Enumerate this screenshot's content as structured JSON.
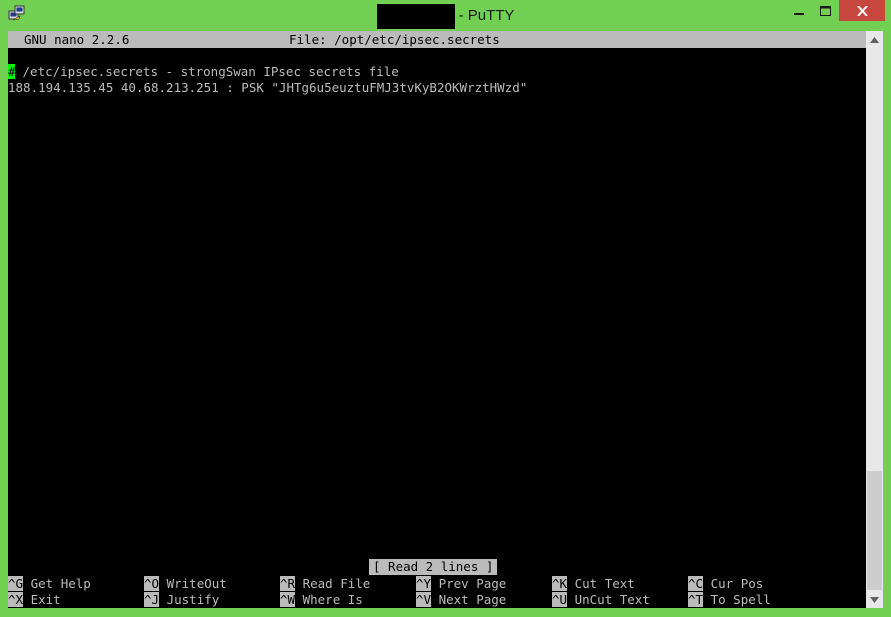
{
  "window": {
    "title_suffix": "- PuTTY",
    "accent": "#71d051",
    "close_color": "#c7463d"
  },
  "nano": {
    "version": "GNU nano 2.2.6",
    "file_label": "File: /opt/etc/ipsec.secrets",
    "lines": [
      {
        "first_char": "#",
        "rest": " /etc/ipsec.secrets - strongSwan IPsec secrets file"
      },
      {
        "text": "188.194.135.45 40.68.213.251 : PSK \"JHTg6u5euztuFMJ3tvKyB2OKWrztHWzd\""
      }
    ],
    "status": "[ Read 2 lines ]",
    "shortcuts_row1": [
      {
        "key": "^G",
        "label": "Get Help"
      },
      {
        "key": "^O",
        "label": "WriteOut"
      },
      {
        "key": "^R",
        "label": "Read File"
      },
      {
        "key": "^Y",
        "label": "Prev Page"
      },
      {
        "key": "^K",
        "label": "Cut Text"
      },
      {
        "key": "^C",
        "label": "Cur Pos"
      }
    ],
    "shortcuts_row2": [
      {
        "key": "^X",
        "label": "Exit"
      },
      {
        "key": "^J",
        "label": "Justify"
      },
      {
        "key": "^W",
        "label": "Where Is"
      },
      {
        "key": "^V",
        "label": "Next Page"
      },
      {
        "key": "^U",
        "label": "UnCut Text"
      },
      {
        "key": "^T",
        "label": "To Spell"
      }
    ]
  },
  "icons": {
    "app": "putty-icon",
    "minimize": "minimize-icon",
    "maximize": "maximize-icon",
    "close": "close-icon",
    "scroll_up": "scroll-up-icon",
    "scroll_down": "scroll-down-icon"
  }
}
